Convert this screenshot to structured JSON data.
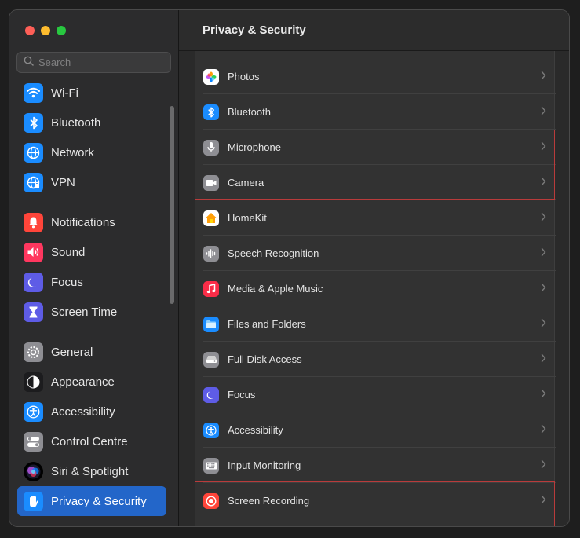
{
  "window": {
    "title": "Privacy & Security",
    "traffic_lights": [
      "close",
      "minimize",
      "zoom"
    ]
  },
  "search": {
    "placeholder": "Search",
    "value": ""
  },
  "sidebar": {
    "selected": "Privacy & Security",
    "groups": [
      [
        {
          "label": "Wi-Fi",
          "icon": "wifi-icon",
          "color": "#1a8cff"
        },
        {
          "label": "Bluetooth",
          "icon": "bluetooth-icon",
          "color": "#1a8cff"
        },
        {
          "label": "Network",
          "icon": "globe-icon",
          "color": "#1a8cff"
        },
        {
          "label": "VPN",
          "icon": "vpn-globe-icon",
          "color": "#1a8cff"
        }
      ],
      [
        {
          "label": "Notifications",
          "icon": "bell-icon",
          "color": "#ff453a"
        },
        {
          "label": "Sound",
          "icon": "speaker-icon",
          "color": "#ff375f"
        },
        {
          "label": "Focus",
          "icon": "moon-icon",
          "color": "#5e5ce6"
        },
        {
          "label": "Screen Time",
          "icon": "hourglass-icon",
          "color": "#5e5ce6"
        }
      ],
      [
        {
          "label": "General",
          "icon": "gear-icon",
          "color": "#8e8e93"
        },
        {
          "label": "Appearance",
          "icon": "appearance-icon",
          "color": "#1c1c1e"
        },
        {
          "label": "Accessibility",
          "icon": "accessibility-icon",
          "color": "#1a8cff"
        },
        {
          "label": "Control Centre",
          "icon": "toggles-icon",
          "color": "#8e8e93"
        },
        {
          "label": "Siri & Spotlight",
          "icon": "siri-icon",
          "color": "#000000"
        },
        {
          "label": "Privacy & Security",
          "icon": "hand-icon",
          "color": "#1a8cff"
        }
      ]
    ]
  },
  "privacy_list": [
    {
      "label": "Photos",
      "icon": "photos-icon",
      "color": "#ffffff"
    },
    {
      "label": "Bluetooth",
      "icon": "bluetooth-icon",
      "color": "#1a8cff"
    },
    {
      "label": "Microphone",
      "icon": "microphone-icon",
      "color": "#8e8e93"
    },
    {
      "label": "Camera",
      "icon": "camera-icon",
      "color": "#8e8e93"
    },
    {
      "label": "HomeKit",
      "icon": "home-icon",
      "color": "#ff9f0a"
    },
    {
      "label": "Speech Recognition",
      "icon": "waveform-icon",
      "color": "#8e8e93"
    },
    {
      "label": "Media & Apple Music",
      "icon": "music-icon",
      "color": "#fa2d48"
    },
    {
      "label": "Files and Folders",
      "icon": "folder-icon",
      "color": "#1a8cff"
    },
    {
      "label": "Full Disk Access",
      "icon": "disk-icon",
      "color": "#8e8e93"
    },
    {
      "label": "Focus",
      "icon": "moon-icon",
      "color": "#5e5ce6"
    },
    {
      "label": "Accessibility",
      "icon": "accessibility-icon",
      "color": "#1a8cff"
    },
    {
      "label": "Input Monitoring",
      "icon": "keyboard-icon",
      "color": "#8e8e93"
    },
    {
      "label": "Screen Recording",
      "icon": "record-icon",
      "color": "#ff453a"
    }
  ],
  "highlight_color": "#b93b3b",
  "highlighted_items": [
    "Microphone",
    "Camera",
    "Screen Recording"
  ]
}
